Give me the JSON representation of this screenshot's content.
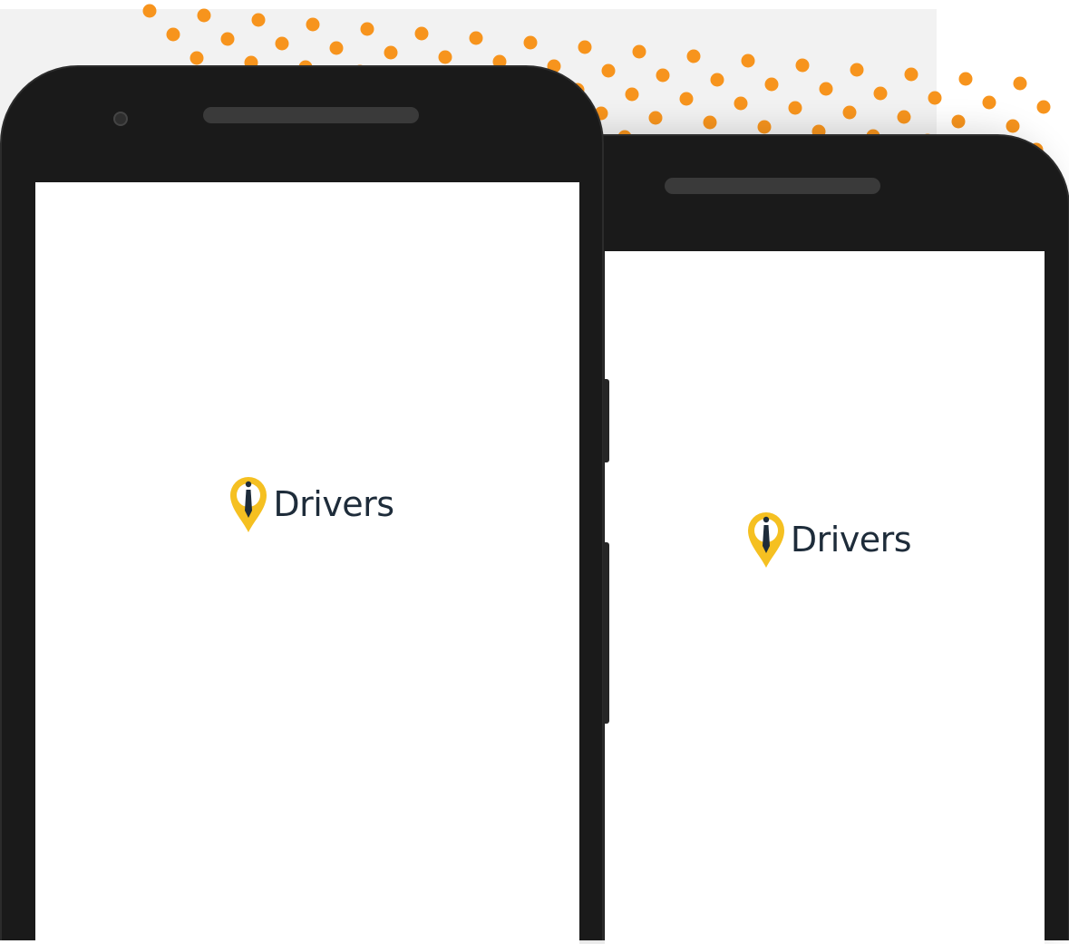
{
  "colors": {
    "accent_dot": "#f7941d",
    "pin_yellow": "#f5c021",
    "phone_body": "#1a1a1a",
    "logo_text": "#1e2c3a"
  },
  "phones": [
    {
      "app_name": "Drivers",
      "icon": "map-pin-driver-icon"
    },
    {
      "app_name": "Drivers",
      "icon": "map-pin-driver-icon"
    }
  ]
}
